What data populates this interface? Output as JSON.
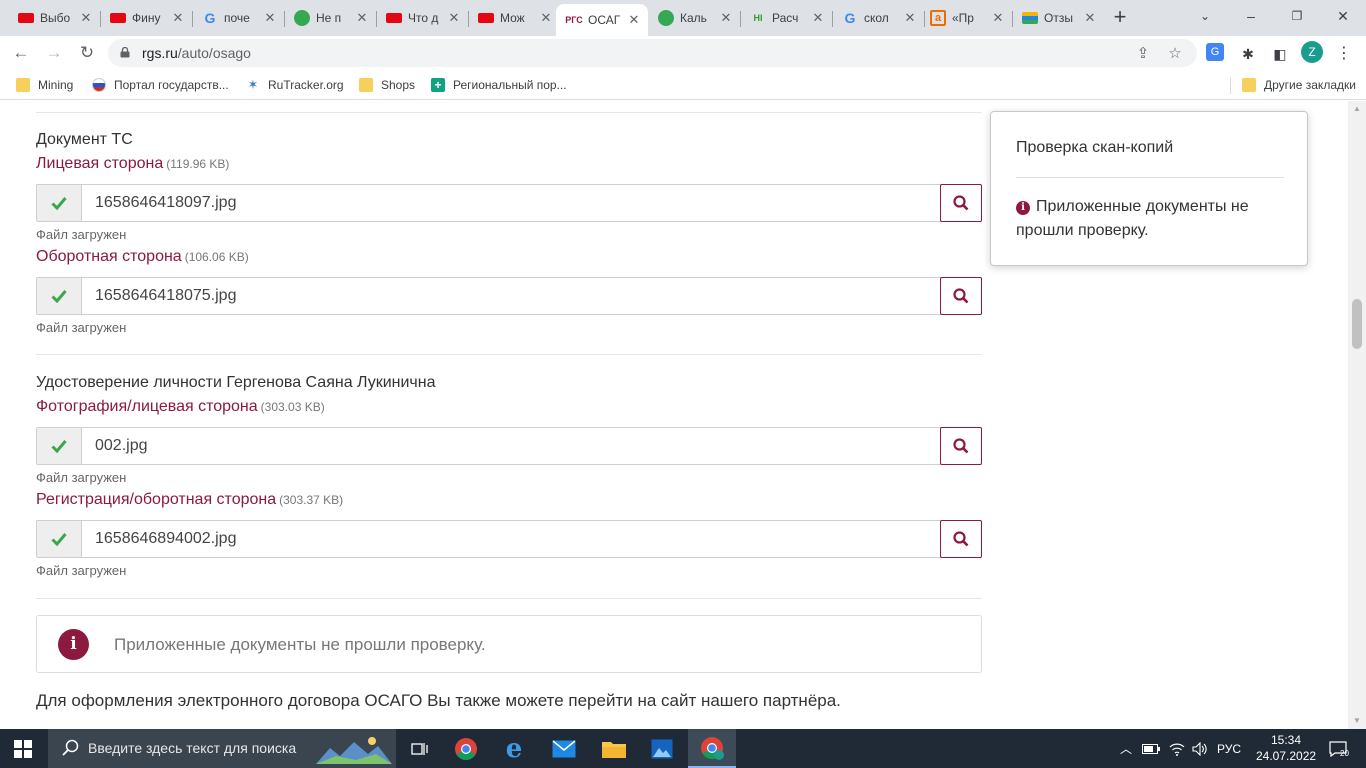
{
  "browser": {
    "tabs": [
      {
        "title": "Выбо",
        "favicon": "flag-icon",
        "color": "#e30613"
      },
      {
        "title": "Фину",
        "favicon": "flag-icon",
        "color": "#e30613"
      },
      {
        "title": "поче",
        "favicon": "google-icon",
        "color": "#4285f4"
      },
      {
        "title": "Не п",
        "favicon": "globe-icon",
        "color": "#34a853"
      },
      {
        "title": "Что д",
        "favicon": "flag-icon",
        "color": "#e30613"
      },
      {
        "title": "Мож",
        "favicon": "flag-icon",
        "color": "#e30613"
      },
      {
        "title": "ОСАГ",
        "favicon": "rgs-icon",
        "color": "#8b1a3e",
        "favicon_text": "РГС"
      },
      {
        "title": "Каль",
        "favicon": "globe-icon",
        "color": "#34a853"
      },
      {
        "title": "Расч",
        "favicon": "hi-icon",
        "color": "#2e9c2e",
        "favicon_text": "HI"
      },
      {
        "title": "скол",
        "favicon": "google-icon",
        "color": "#4285f4"
      },
      {
        "title": "«Пр",
        "favicon": "a-icon",
        "color": "#ef6c00"
      },
      {
        "title": "Отзы",
        "favicon": "stack-icon",
        "color": "#1e88e5"
      }
    ],
    "url_host": "rgs.ru",
    "url_path": "/auto/osago",
    "profile_letter": "Z"
  },
  "bookmarks": [
    {
      "label": "Mining",
      "icon": "folder-icon"
    },
    {
      "label": "Портал государств...",
      "icon": "russia-flag-icon"
    },
    {
      "label": "RuTracker.org",
      "icon": "rutracker-icon"
    },
    {
      "label": "Shops",
      "icon": "folder-icon"
    },
    {
      "label": "Региональный пор...",
      "icon": "plus-icon"
    }
  ],
  "bookmarks_other": "Другие закладки",
  "vehicle_doc": {
    "title": "Документ ТС",
    "front": {
      "label": "Лицевая сторона",
      "size": "(119.96 KB)",
      "filename": "1658646418097.jpg",
      "status": "Файл загружен"
    },
    "back": {
      "label": "Оборотная сторона",
      "size": "(106.06 KB)",
      "filename": "1658646418075.jpg",
      "status": "Файл загружен"
    }
  },
  "id_doc": {
    "title": "Удостоверение личности Гергенова Саяна Лукинична",
    "front": {
      "label": "Фотография/лицевая сторона",
      "size": "(303.03 KB)",
      "filename": "002.jpg",
      "status": "Файл загружен"
    },
    "back": {
      "label": "Регистрация/оборотная сторона",
      "size": "(303.37 KB)",
      "filename": "1658646894002.jpg",
      "status": "Файл загружен"
    }
  },
  "alert": {
    "icon_text": "i",
    "message": "Приложенные документы не прошли проверку."
  },
  "partner_text": "Для оформления электронного договора ОСАГО Вы также можете перейти на сайт нашего партнёра.",
  "popover": {
    "title": "Проверка скан-копий",
    "icon_text": "i",
    "message": "Приложенные документы не прошли проверку."
  },
  "taskbar": {
    "search_placeholder": "Введите здесь текст для поиска",
    "language": "РУС",
    "time": "15:34",
    "date": "24.07.2022",
    "notifications_count": "20"
  },
  "colors": {
    "brand": "#8b1a3e",
    "check": "#3aa84a",
    "taskbar": "#1f2a36"
  }
}
